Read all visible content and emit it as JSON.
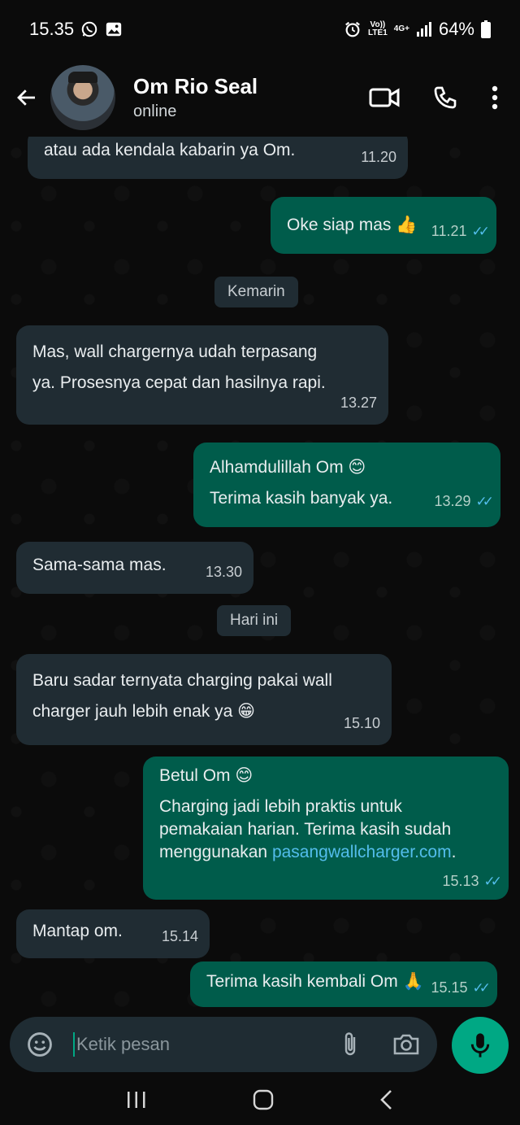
{
  "status_bar": {
    "time": "15.35",
    "volte": "Vo))",
    "lte": "LTE1",
    "net_type": "4G+",
    "battery": "64%"
  },
  "header": {
    "contact_name": "Om Rio Seal",
    "contact_status": "online"
  },
  "messages": [
    {
      "text": "atau ada kendala kabarin ya Om.",
      "time": "11.20"
    },
    {
      "text": "Oke siap mas 👍",
      "time": "11.21"
    },
    {
      "date": "Kemarin"
    },
    {
      "line1": "Mas, wall chargernya udah terpasang",
      "line2": "ya. Prosesnya cepat dan hasilnya rapi.",
      "time": "13.27"
    },
    {
      "line1": "Alhamdulillah Om 😊",
      "line2": "Terima kasih banyak ya.",
      "time": "13.29"
    },
    {
      "text": "Sama-sama mas.",
      "time": "13.30"
    },
    {
      "date": "Hari ini"
    },
    {
      "line1": "Baru sadar ternyata charging pakai wall",
      "line2": "charger jauh lebih enak ya 😁",
      "time": "15.10"
    },
    {
      "line1": "Betul Om 😊",
      "line2": "Charging jadi lebih praktis untuk",
      "line3": "pemakaian harian. Terima kasih sudah",
      "line4_prefix": "menggunakan ",
      "link": "pasangwallcharger.com",
      "line4_suffix": ".",
      "time": "15.13"
    },
    {
      "text": "Mantap om.",
      "time": "15.14"
    },
    {
      "text": "Terima kasih kembali Om 🙏",
      "time": "15.15"
    }
  ],
  "composer": {
    "placeholder": "Ketik pesan"
  },
  "colors": {
    "incoming": "#202c33",
    "outgoing": "#005c4b",
    "accent": "#00a884",
    "read_ticks": "#53bdeb"
  }
}
